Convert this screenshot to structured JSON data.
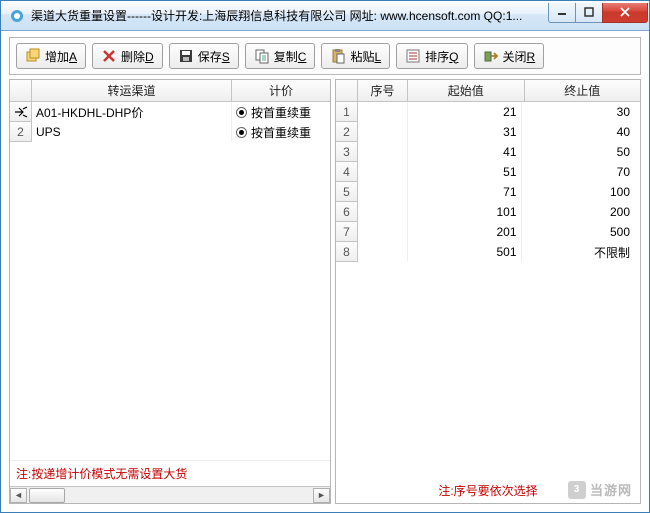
{
  "window": {
    "title": "渠道大货重量设置------设计开发:上海辰翔信息科技有限公司 网址: www.hcensoft.com QQ:1..."
  },
  "toolbar": {
    "add": {
      "label": "增加",
      "hotkey": "A"
    },
    "del": {
      "label": "删除",
      "hotkey": "D"
    },
    "save": {
      "label": "保存",
      "hotkey": "S"
    },
    "copy": {
      "label": "复制",
      "hotkey": "C"
    },
    "paste": {
      "label": "粘贴",
      "hotkey": "L"
    },
    "sort": {
      "label": "排序",
      "hotkey": "Q"
    },
    "close": {
      "label": "关闭",
      "hotkey": "R"
    }
  },
  "left": {
    "headers": {
      "channel": "转运渠道",
      "pricing": "计价"
    },
    "rows": [
      {
        "ind": "▶",
        "channel": "A01-HKDHL-DHP价",
        "pricing": "按首重续重"
      },
      {
        "ind": "2",
        "channel": "UPS",
        "pricing": "按首重续重"
      }
    ],
    "note": "注:按递增计价模式无需设置大货"
  },
  "right": {
    "headers": {
      "seq": "序号",
      "start": "起始值",
      "end": "终止值"
    },
    "rows": [
      {
        "seq": "1",
        "start": "21",
        "end": "30"
      },
      {
        "seq": "2",
        "start": "31",
        "end": "40"
      },
      {
        "seq": "3",
        "start": "41",
        "end": "50"
      },
      {
        "seq": "4",
        "start": "51",
        "end": "70"
      },
      {
        "seq": "5",
        "start": "71",
        "end": "100"
      },
      {
        "seq": "6",
        "start": "101",
        "end": "200"
      },
      {
        "seq": "7",
        "start": "201",
        "end": "500"
      },
      {
        "seq": "8",
        "start": "501",
        "end": "不限制"
      }
    ],
    "note": "注:序号要依次选择"
  },
  "watermark": "当游网"
}
